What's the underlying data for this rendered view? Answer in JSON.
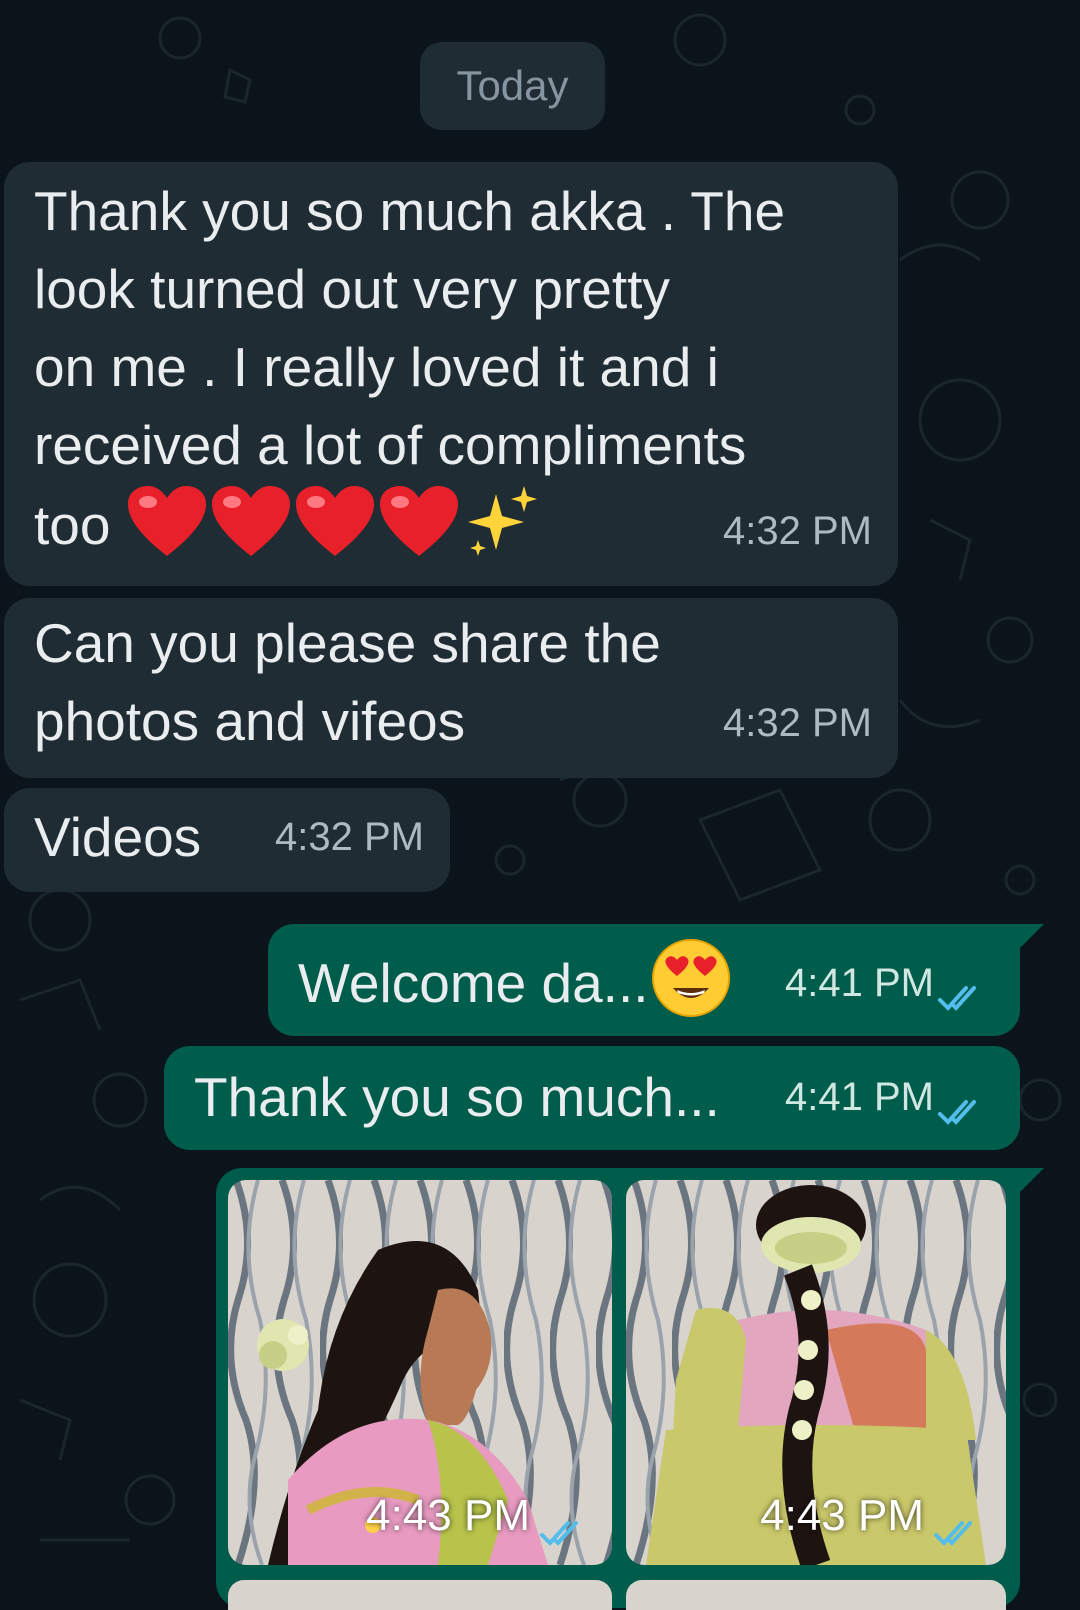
{
  "date_divider": "Today",
  "messages": [
    {
      "direction": "incoming",
      "lines": [
        "Thank you so much akka . The",
        "look turned out very pretty",
        "on me . I really loved it and i",
        "received a lot of compliments",
        "too"
      ],
      "emoji": [
        "red-heart",
        "red-heart",
        "red-heart",
        "red-heart",
        "sparkles"
      ],
      "time": "4:32 PM"
    },
    {
      "direction": "incoming",
      "lines": [
        "Can you please share the",
        "photos and vifeos"
      ],
      "time": "4:32 PM"
    },
    {
      "direction": "incoming",
      "lines": [
        "Videos"
      ],
      "time": "4:32 PM"
    },
    {
      "direction": "outgoing",
      "lines": [
        "Welcome da..."
      ],
      "emoji": [
        "heart-eyes"
      ],
      "time": "4:41 PM",
      "status": "read"
    },
    {
      "direction": "outgoing",
      "lines": [
        "Thank you so much..."
      ],
      "time": "4:41 PM",
      "status": "read"
    },
    {
      "direction": "outgoing",
      "type": "photo-album",
      "photos": [
        {
          "subject": "side-braid-hairstyle-photo",
          "time": "4:43 PM",
          "status": "read"
        },
        {
          "subject": "back-braid-hairstyle-photo",
          "time": "4:43 PM",
          "status": "read"
        }
      ]
    }
  ],
  "colors": {
    "background": "#0b141a",
    "incoming_bubble": "#202c33",
    "outgoing_bubble": "#005c4b",
    "read_ticks": "#53bdeb",
    "date_pill": "#1f2c34"
  }
}
